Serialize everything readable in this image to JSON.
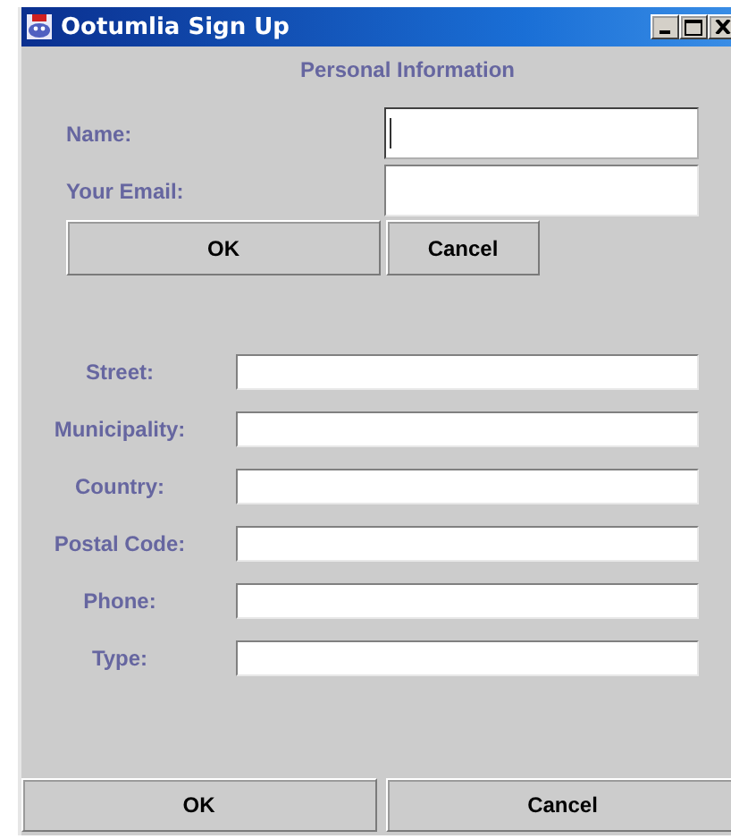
{
  "window": {
    "title": "Ootumlia Sign Up"
  },
  "heading": "Personal Information",
  "account_fields": [
    {
      "label": "Name:",
      "focused": true
    },
    {
      "label": "Your Email:",
      "focused": false
    }
  ],
  "account_buttons": [
    "OK",
    "Cancel"
  ],
  "address_fields": [
    {
      "label": "Street:"
    },
    {
      "label": "Municipality:"
    },
    {
      "label": "Country:"
    },
    {
      "label": "Postal Code:"
    },
    {
      "label": "Phone:"
    },
    {
      "label": "Type:"
    }
  ],
  "bottom_buttons": [
    "OK",
    "Cancel"
  ]
}
